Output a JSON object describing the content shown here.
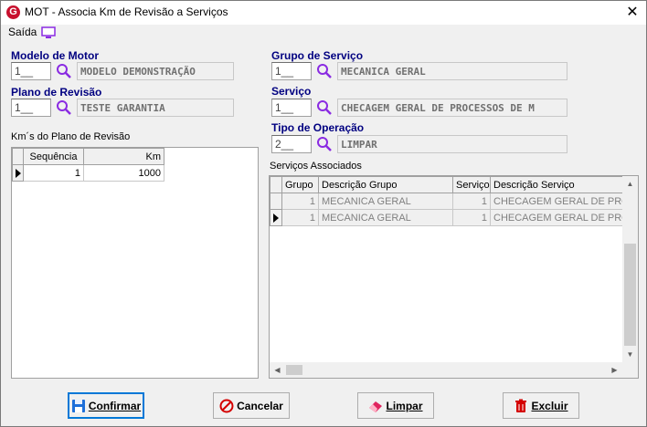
{
  "window": {
    "title": "MOT - Associa Km de Revisão a Serviços",
    "close": "✕"
  },
  "menu": {
    "saida": "Saída"
  },
  "fields": {
    "modelo": {
      "label": "Modelo de Motor",
      "code": "1__",
      "desc": "MODELO DEMONSTRAÇÃO"
    },
    "plano": {
      "label": "Plano de Revisão",
      "code": "1__",
      "desc": "TESTE GARANTIA"
    },
    "grupo": {
      "label": "Grupo de Serviço",
      "code": "1__",
      "desc": "MECANICA GERAL"
    },
    "servico": {
      "label": "Serviço",
      "code": "1__",
      "desc": "CHECAGEM GERAL DE PROCESSOS DE M"
    },
    "tipo": {
      "label": "Tipo de Operação",
      "code": "2__",
      "desc": "LIMPAR"
    }
  },
  "km_grid": {
    "title": "Km´s do Plano de Revisão",
    "headers": [
      "Sequência",
      "Km"
    ],
    "rows": [
      {
        "seq": "1",
        "km": "1000"
      }
    ]
  },
  "svc_grid": {
    "title": "Serviços Associados",
    "headers": [
      "Grupo",
      "Descrição Grupo",
      "Serviço",
      "Descrição Serviço"
    ],
    "rows": [
      {
        "grupo": "1",
        "desc_grupo": "MECANICA GERAL",
        "servico": "1",
        "desc_servico": "CHECAGEM GERAL DE PRO"
      },
      {
        "grupo": "1",
        "desc_grupo": "MECANICA GERAL",
        "servico": "1",
        "desc_servico": "CHECAGEM GERAL DE PRO"
      }
    ]
  },
  "buttons": {
    "confirmar": "Confirmar",
    "cancelar": "Cancelar",
    "limpar": "Limpar",
    "excluir": "Excluir"
  },
  "colors": {
    "label_blue": "#000080",
    "focus_blue": "#0078d7",
    "brand_red": "#c8102e"
  },
  "icons": {
    "app": "app-logo-icon",
    "menu": "monitor-icon",
    "lookup": "search-icon"
  }
}
